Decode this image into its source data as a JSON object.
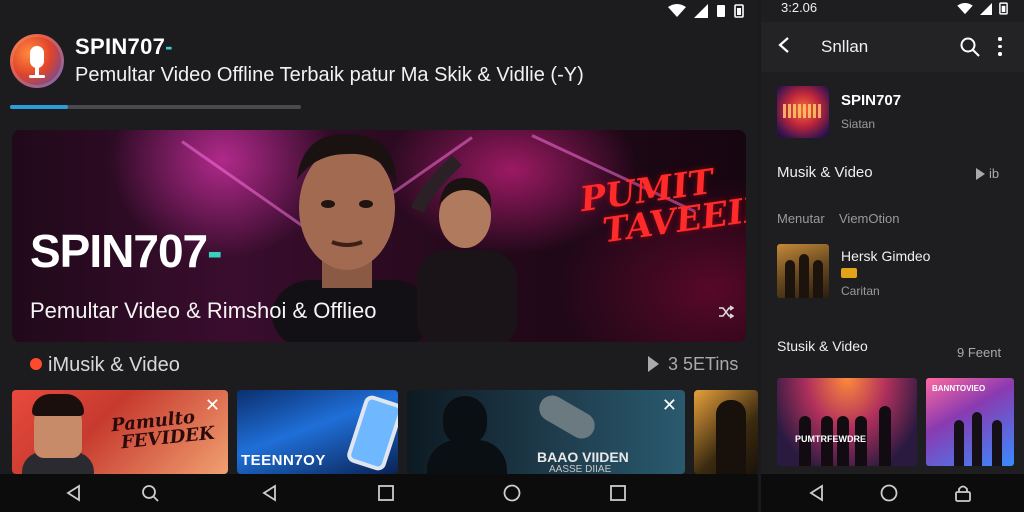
{
  "main": {
    "header": {
      "brand": "SPIN707",
      "brand_dash": "-",
      "tagline": "Pemultar Video Offline Terbaik patur Ma Skik & Vidlie (-Y)"
    },
    "load_progress": 0.2,
    "hero": {
      "title": "SPIN707",
      "title_dash": "-",
      "subtitle": "Pemultar Video & Rimshoi & Offlieo",
      "poster_line1": "PUMIT",
      "poster_line2": "TAVEEIK",
      "shuffle_icon": "shuffle-icon"
    },
    "section": {
      "title": "iMusik & Video",
      "count": "3 5ETins"
    },
    "thumbnails": [
      {
        "label": "Pamulto\nFEVIDEK",
        "close": "✕"
      },
      {
        "label": "TEENN7OY"
      },
      {
        "label": "BAAO VIIDEN",
        "sub": "AASSE DIIAE",
        "close": "✕"
      },
      {
        "label": ""
      }
    ],
    "nav_icons": [
      "back-icon",
      "search-icon",
      "back-icon",
      "square-icon",
      "home-icon",
      "square-icon"
    ]
  },
  "side": {
    "status_time": "3:2.06",
    "topbar": {
      "back": "‹",
      "title": "Snllan"
    },
    "app_card": {
      "name": "SPIN707",
      "sub": "Siatan"
    },
    "section1": {
      "title": "Musik & Video",
      "more": "ib"
    },
    "meta": {
      "left": "Menutar",
      "right": "ViemOtion"
    },
    "item": {
      "title": "Hersk Gimdeo",
      "sub": "Caritan"
    },
    "section2": {
      "title": "Stusik & Video",
      "more": "9 Feent"
    },
    "thumb_bands": [
      "PUMTRFEWDRE",
      "BANNTOVIEO"
    ],
    "nav_icons": [
      "back-icon",
      "home-icon",
      "lock-icon"
    ]
  },
  "colors": {
    "accent_blue": "#2d9cdb",
    "brand_teal": "#3ad0c0",
    "poster_red": "#ff2a2a",
    "section_dot": "#ff4b2b"
  }
}
